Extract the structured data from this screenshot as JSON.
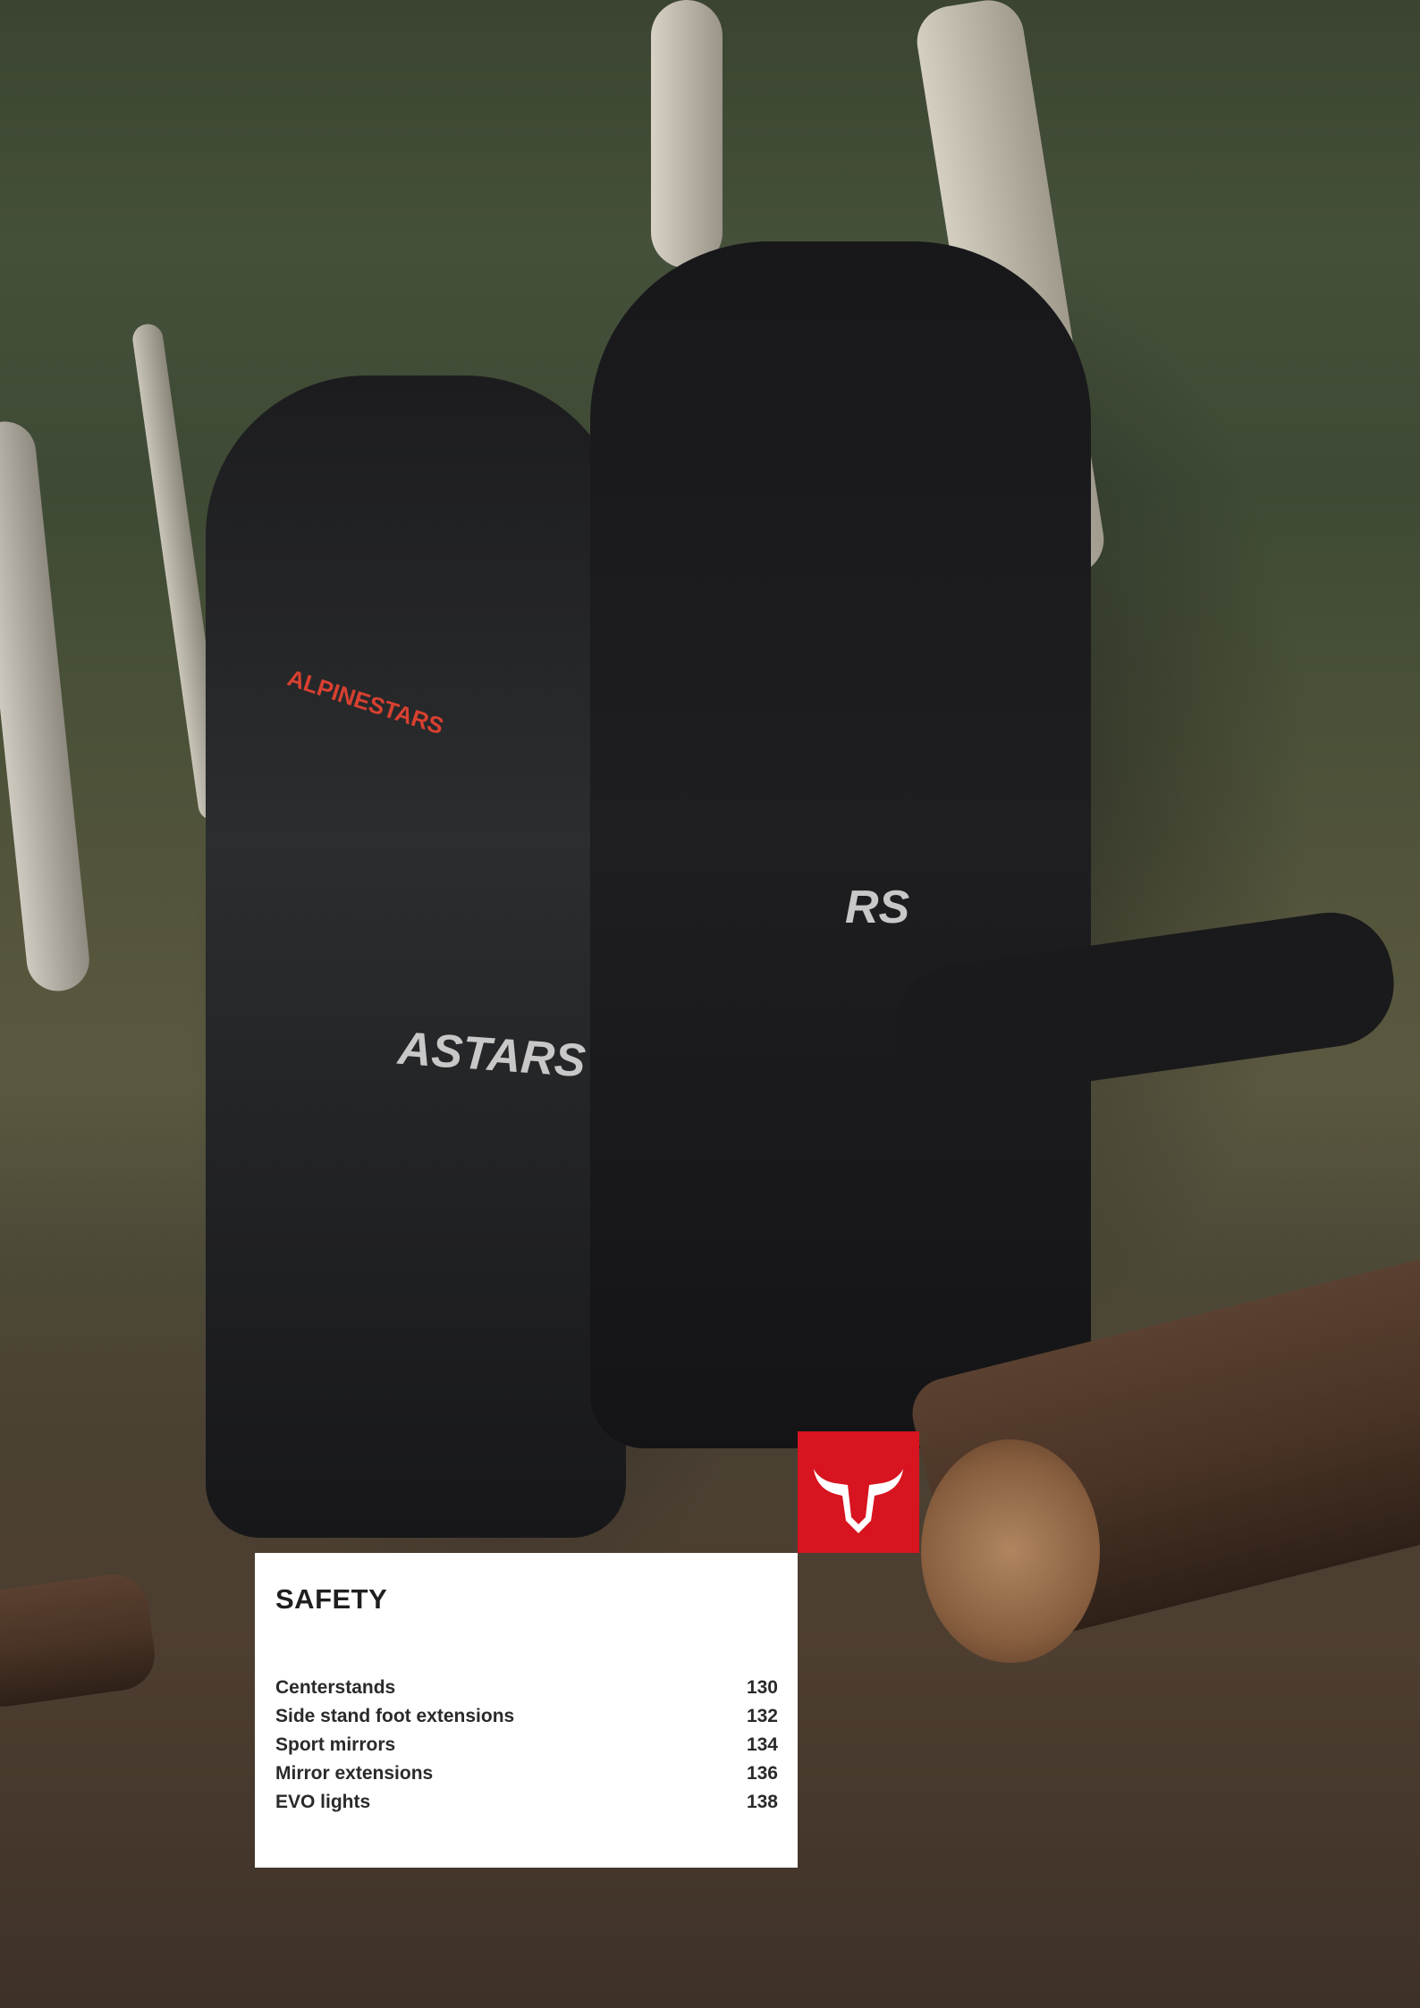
{
  "section": {
    "title": "SAFETY"
  },
  "toc": {
    "items": [
      {
        "label": "Centerstands",
        "page": "130"
      },
      {
        "label": "Side stand foot extensions",
        "page": "132"
      },
      {
        "label": "Sport mirrors",
        "page": "134"
      },
      {
        "label": "Mirror extensions",
        "page": "136"
      },
      {
        "label": "EVO lights",
        "page": "138"
      }
    ]
  },
  "photo": {
    "jacket_text_left": "ALPINESTARS",
    "pants_text_left": "ASTARS",
    "pants_text_right": "RS"
  },
  "colors": {
    "brand_red": "#d7141f",
    "panel_bg": "#ffffff",
    "text": "#1f1f1f"
  },
  "icons": {
    "brand_logo": "bull-head-icon"
  }
}
